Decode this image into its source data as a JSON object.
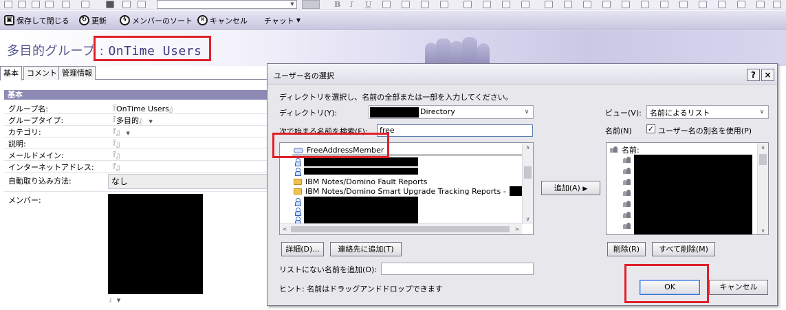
{
  "toolbar": {
    "save_close": "保存して閉じる",
    "refresh": "更新",
    "sort_members": "メンバーのソート",
    "cancel": "キャンセル",
    "chat": "チャット"
  },
  "document": {
    "title_prefix": "多目的グループ : ",
    "title_name": "OnTime Users"
  },
  "tabs": [
    "基本",
    "コメント",
    "管理情報"
  ],
  "form": {
    "section_label": "基本",
    "fields": [
      {
        "label": "グループ名:",
        "value": "OnTime Users"
      },
      {
        "label": "グループタイプ:",
        "value": "多目的"
      },
      {
        "label": "カテゴリ:",
        "value": ""
      },
      {
        "label": "説明:",
        "value": ""
      },
      {
        "label": "メールドメイン:",
        "value": ""
      },
      {
        "label": "インターネットアドレス:",
        "value": ""
      }
    ],
    "auto_capture_label": "自動取り込み方法:",
    "auto_capture_value": "なし",
    "members_label": "メンバー:",
    "bracket_open": "『",
    "bracket_close": "』"
  },
  "dialog": {
    "title": "ユーザー名の選択",
    "help_button": "?",
    "close_button": "×",
    "instruction": "ディレクトリを選択し、名前の全部または一部を入力してください。",
    "directory_label": "ディレクトリ(Y):",
    "directory_value_suffix": "Directory",
    "search_label": "次で始まる名前を検索(F):",
    "search_value": "free",
    "results": [
      {
        "type": "group",
        "text": "FreeAddressMember"
      },
      {
        "type": "person",
        "text": ""
      },
      {
        "type": "person",
        "text": ""
      },
      {
        "type": "folder",
        "text": "IBM Notes/Domino Fault Reports"
      },
      {
        "type": "folder",
        "text": "IBM Notes/Domino Smart Upgrade Tracking Reports -"
      },
      {
        "type": "person",
        "text": ""
      },
      {
        "type": "person",
        "text": ""
      },
      {
        "type": "person",
        "text": ""
      },
      {
        "type": "person",
        "text": ""
      }
    ],
    "add_button": "追加(A)",
    "details_button": "詳細(D)...",
    "add_to_contacts_button": "連絡先に追加(T)",
    "add_unlisted_label": "リストにない名前を追加(O):",
    "add_unlisted_value": "",
    "hint": "ヒント: 名前はドラッグアンドドロップできます",
    "view_label": "ビュー(V):",
    "view_value": "名前によるリスト",
    "name_label": "名前(N)",
    "alias_checkbox_label": "ユーザー名の別名を使用(P)",
    "alias_checked": true,
    "selected_header": "名前:",
    "selected_count": 8,
    "delete_button": "削除(R)",
    "delete_all_button": "すべて削除(M)",
    "ok_button": "OK",
    "cancel_button": "キャンセル"
  }
}
